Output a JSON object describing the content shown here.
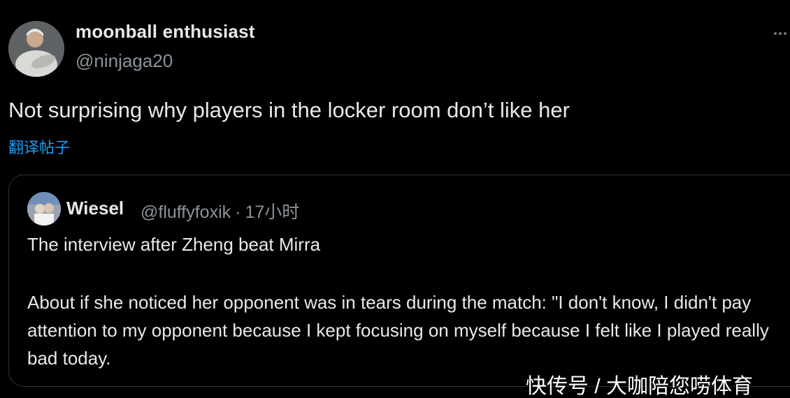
{
  "tweet": {
    "display_name": "moonball enthusiast",
    "handle": "@ninjaga20",
    "text": "Not surprising why players in the locker room don’t like her",
    "translate_label": "翻译帖子",
    "more_icon": "more-dots-icon"
  },
  "quote": {
    "display_name": "Wiesel",
    "handle": "@fluffyfoxik",
    "separator": "·",
    "time": "17小时",
    "line1": "The interview after Zheng beat Mirra",
    "line2": "About if she noticed her opponent was in tears during the match: \"I don't know, I didn't pay attention to my opponent because I kept focusing on myself because I felt like I played really bad today."
  },
  "watermark": "快传号 / 大咖陪您唠体育",
  "colors": {
    "background": "#000000",
    "text": "#e7e9ea",
    "muted": "#8b9399",
    "link": "#1d9bf0",
    "border": "#2f3336"
  }
}
